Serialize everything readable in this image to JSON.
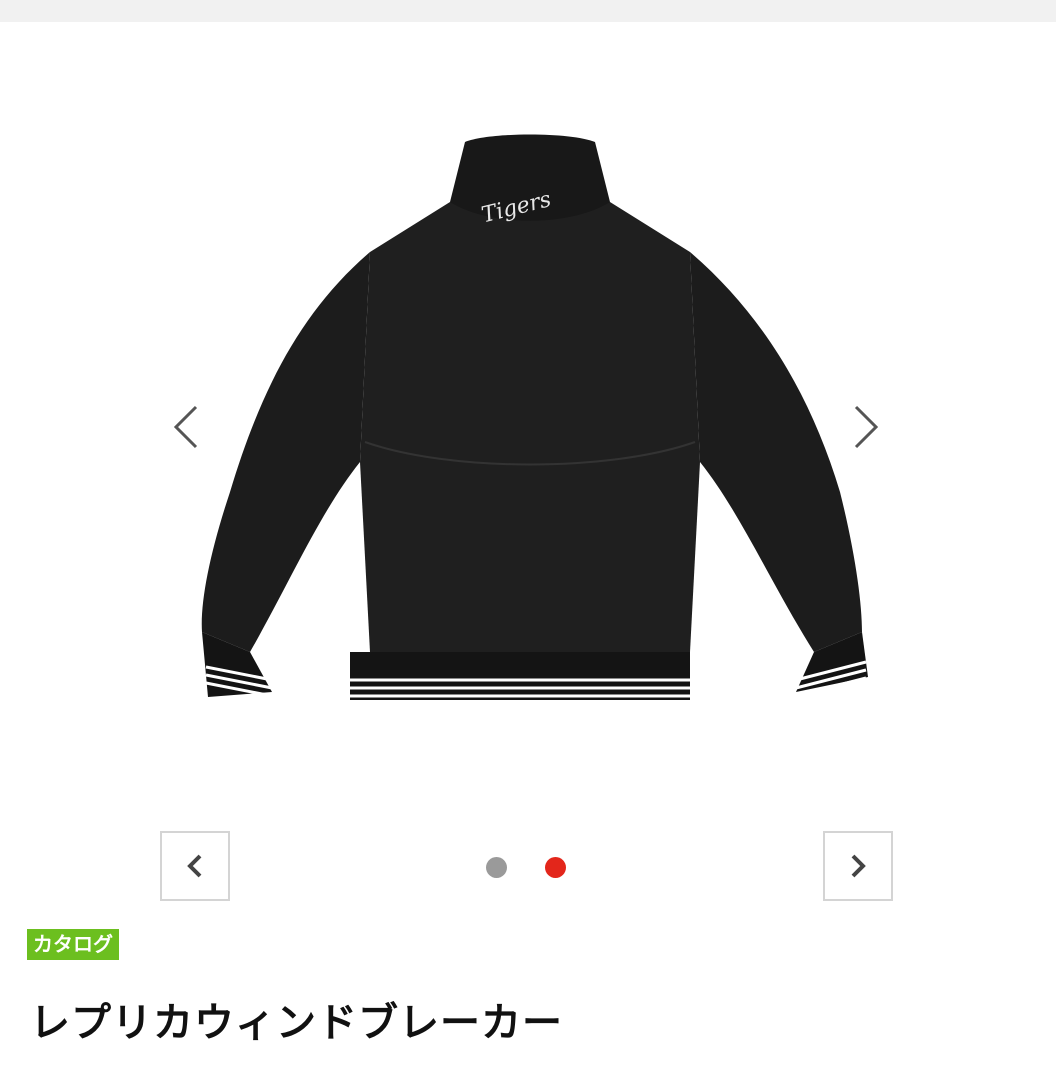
{
  "product": {
    "badge": "カタログ",
    "title": "レプリカウィンドブレーカー",
    "image": {
      "embroidery_text": "Tigers",
      "icon": "jacket-back-image"
    }
  },
  "gallery": {
    "prev_icon": "chevron-left-icon",
    "next_icon": "chevron-right-icon",
    "dots": [
      {
        "state": "inactive",
        "color": "#9a9a9a"
      },
      {
        "state": "active",
        "color": "#e3261b"
      }
    ]
  },
  "colors": {
    "badge_bg": "#6cbf1f",
    "active_dot": "#e3261b",
    "inactive_dot": "#9a9a9a",
    "top_bar": "#f1f1f1"
  }
}
